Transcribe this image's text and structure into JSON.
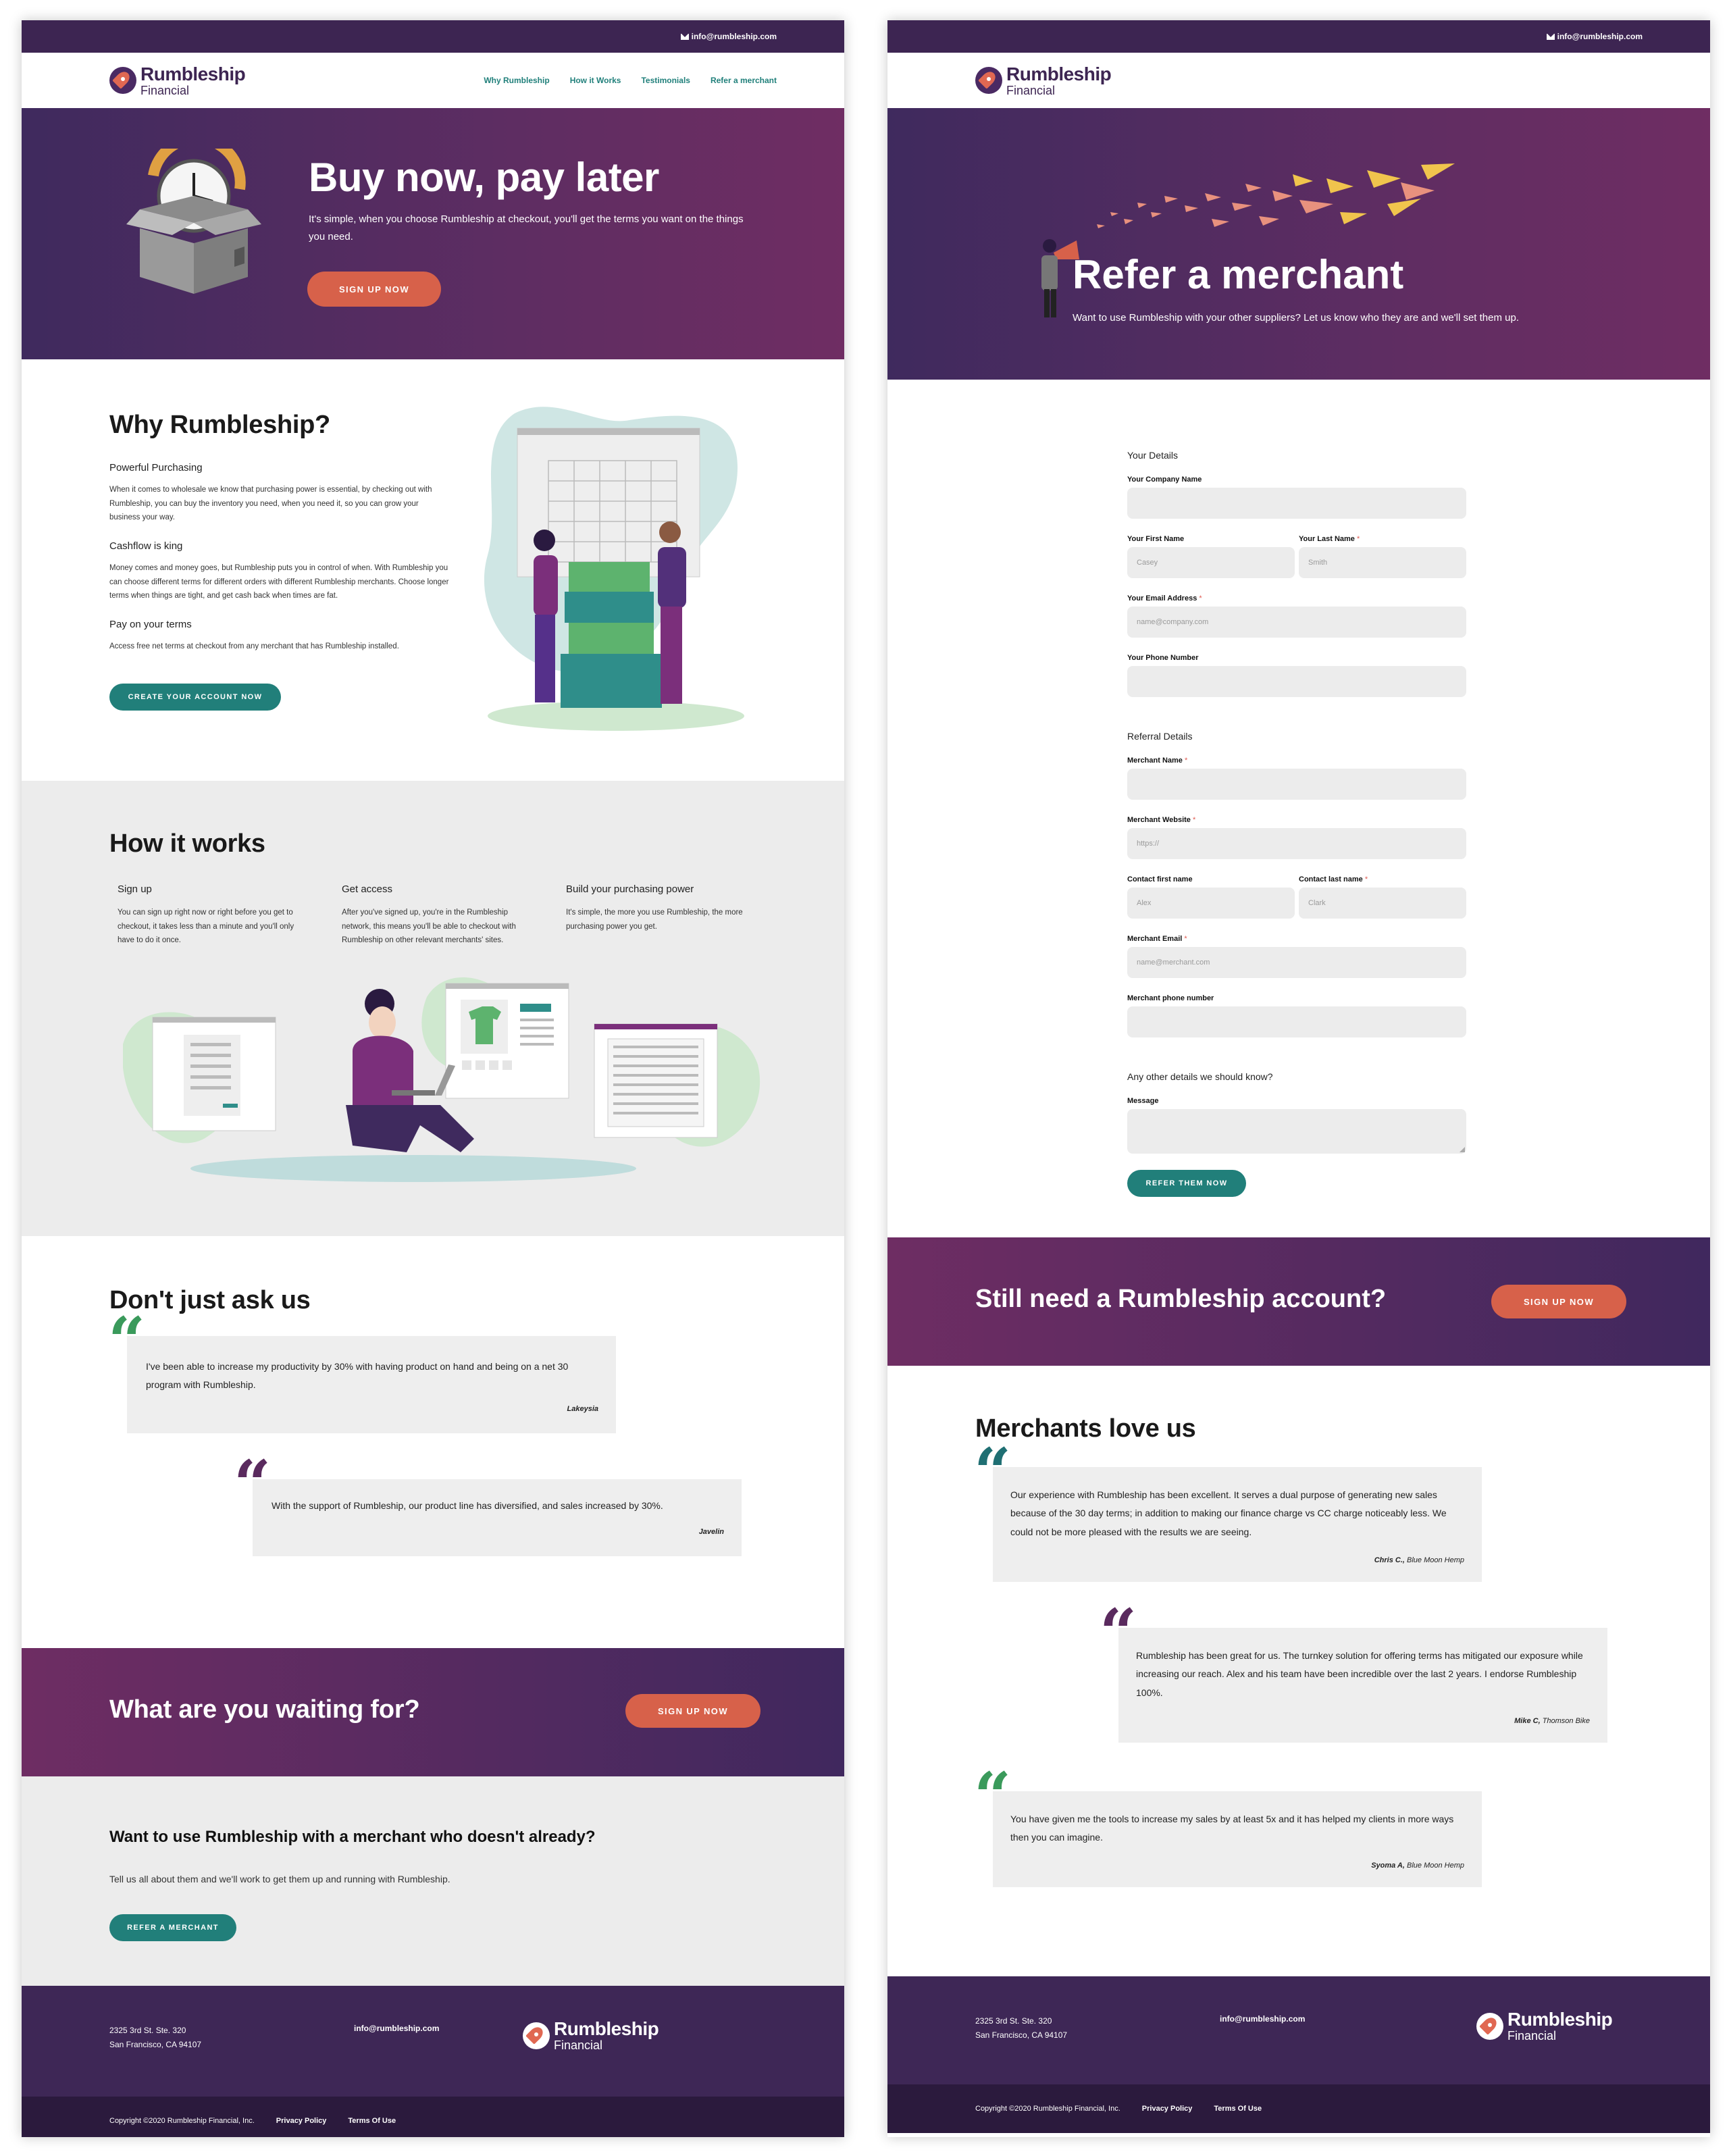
{
  "brand": {
    "name": "Rumbleship",
    "sub": "Financial"
  },
  "contact_email": "info@rumbleship.com",
  "nav": [
    "Why Rumbleship",
    "How it Works",
    "Testimonials",
    "Refer a merchant"
  ],
  "hero": {
    "title": "Buy now, pay later",
    "subtitle": "It's simple, when you choose Rumbleship at checkout, you'll get the terms you want on the things you need.",
    "cta": "SIGN UP NOW"
  },
  "why": {
    "title": "Why Rumbleship?",
    "items": [
      {
        "heading": "Powerful Purchasing",
        "text": "When it comes to wholesale we know that purchasing power is essential, by checking out with Rumbleship, you can buy the inventory you need, when you need it, so you can grow your business your way."
      },
      {
        "heading": "Cashflow is king",
        "text": "Money comes and money goes, but Rumbleship puts you in control of when. With Rumbleship you can choose different terms for different orders with different Rumbleship merchants. Choose longer terms when things are tight, and get cash back when times are fat."
      },
      {
        "heading": "Pay on your terms",
        "text": "Access free net terms at checkout from any merchant that has Rumbleship installed."
      }
    ],
    "cta": "CREATE YOUR ACCOUNT NOW"
  },
  "how": {
    "title": "How it works",
    "steps": [
      {
        "heading": "Sign up",
        "text": "You can sign up right now or right before you get to checkout, it takes less than a minute and you'll only have to do it once."
      },
      {
        "heading": "Get access",
        "text": "After you've signed up, you're in the Rumbleship network, this means you'll be able to checkout with Rumbleship on other relevant merchants' sites."
      },
      {
        "heading": "Build your purchasing power",
        "text": "It's simple, the more you use Rumbleship, the more purchasing power you get."
      }
    ]
  },
  "testimonials": {
    "title": "Don't just ask us",
    "quotes": [
      {
        "text": "I've been able to increase my productivity by 30% with having product on hand and being on a net 30 program with Rumbleship.",
        "author": "Lakeysia"
      },
      {
        "text": "With the support of Rumbleship, our product line has diversified, and sales increased by 30%.",
        "author": "Javelin"
      }
    ]
  },
  "waiting": {
    "title": "What are you waiting for?",
    "cta": "SIGN UP NOW"
  },
  "want": {
    "title": "Want to use Rumbleship with a merchant who doesn't already?",
    "text": "Tell us all about them and we'll work to get them up and running with Rumbleship.",
    "cta": "REFER A MERCHANT"
  },
  "footer": {
    "addr1": "2325 3rd St. Ste. 320",
    "addr2": "San Francisco, CA 94107",
    "copyright": "Copyright ©2020 Rumbleship Financial, Inc.",
    "privacy": "Privacy Policy",
    "terms": "Terms Of Use"
  },
  "refer": {
    "title": "Refer a merchant",
    "subtitle": "Want to use Rumbleship with your other suppliers? Let us know who they are and we'll set them up."
  },
  "form": {
    "your_details": "Your Details",
    "company": "Your Company Name",
    "first": "Your First Name",
    "first_ph": "Casey",
    "last": "Your Last Name",
    "last_ph": "Smith",
    "email": "Your Email Address",
    "email_ph": "name@company.com",
    "phone": "Your Phone Number",
    "referral_details": "Referral Details",
    "merchant_name": "Merchant Name",
    "website": "Merchant Website",
    "website_ph": "https://",
    "cfirst": "Contact first name",
    "cfirst_ph": "Alex",
    "clast": "Contact last name",
    "clast_ph": "Clark",
    "memail": "Merchant Email",
    "memail_ph": "name@merchant.com",
    "mphone": "Merchant phone number",
    "other": "Any other details we should know?",
    "message": "Message",
    "req": "*",
    "submit": "REFER THEM NOW"
  },
  "still": {
    "title": "Still need a Rumbleship account?",
    "cta": "SIGN UP NOW"
  },
  "merchants": {
    "title": "Merchants love us",
    "quotes": [
      {
        "text": "Our experience with Rumbleship has been excellent. It serves a dual purpose of generating new sales because of the 30 day terms; in addition to making our finance charge vs CC charge noticeably less. We could not be more pleased with the results we are seeing.",
        "author": "Chris C.,",
        "company": "Blue Moon Hemp"
      },
      {
        "text": "Rumbleship has been great for us. The turnkey solution for offering terms has mitigated our exposure while increasing our reach. Alex and his team have been incredible over the last 2 years. I endorse Rumbleship 100%.",
        "author": "Mike C,",
        "company": "Thomson Bike"
      },
      {
        "text": "You have given me the tools to increase my sales by at least 5x and it has helped my clients in more ways then you can imagine.",
        "author": "Syoma A,",
        "company": "Blue Moon Hemp"
      }
    ]
  },
  "colors": {
    "purple": "#3d2552",
    "orange": "#d7614a",
    "teal": "#217f7a",
    "green_quote": "#3a9a5b",
    "purple_quote": "#5a2a5e",
    "teal_quote": "#1f6f73"
  }
}
